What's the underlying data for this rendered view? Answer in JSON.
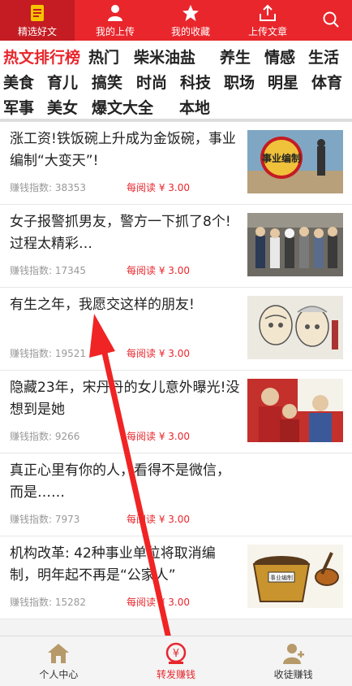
{
  "top_tabs": [
    {
      "label": "精选好文",
      "icon": "article-icon"
    },
    {
      "label": "我的上传",
      "icon": "user-icon"
    },
    {
      "label": "我的收藏",
      "icon": "star-icon"
    },
    {
      "label": "上传文章",
      "icon": "upload-icon"
    },
    {
      "label": "",
      "icon": "search-icon"
    }
  ],
  "categories": {
    "row1": [
      "热文排行榜",
      "热门",
      "柴米油盐",
      "养生",
      "情感",
      "生活"
    ],
    "row2": [
      "美食",
      "育儿",
      "搞笑",
      "时尚",
      "科技",
      "职场",
      "明星",
      "体育"
    ],
    "row3": [
      "军事",
      "美女",
      "爆文大全",
      "本地"
    ]
  },
  "articles": [
    {
      "title": "涨工资!铁饭碗上升成为金饭碗，事业编制“大变天”!",
      "index_label": "赚钱指数: 38353",
      "reward": "每阅读 ¥ 3.00",
      "thumb_text": "事业编制"
    },
    {
      "title": "女子报警抓男友，警方一下抓了8个!过程太精彩…",
      "index_label": "赚钱指数: 17345",
      "reward": "每阅读 ¥ 3.00",
      "thumb_text": ""
    },
    {
      "title": "有生之年，我愿交这样的朋友!",
      "index_label": "赚钱指数: 19521",
      "reward": "每阅读 ¥ 3.00",
      "thumb_text": ""
    },
    {
      "title": "隐藏23年，宋丹丹的女儿意外曝光!没想到是她",
      "index_label": "赚钱指数: 9266",
      "reward": "每阅读 ¥ 3.00",
      "thumb_text": ""
    },
    {
      "title": "真正心里有你的人，看得不是微信，而是……",
      "index_label": "赚钱指数: 7973",
      "reward": "每阅读 ¥ 3.00",
      "thumb_text": ""
    },
    {
      "title": "机构改革: 42种事业单位将取消编制，明年起不再是“公家人”",
      "index_label": "赚钱指数: 15282",
      "reward": "每阅读 ¥ 3.00",
      "thumb_text": "事业编制"
    }
  ],
  "bottom_tabs": [
    {
      "label": "个人中心",
      "icon": "home-icon"
    },
    {
      "label": "转发赚钱",
      "icon": "yuan-coin-icon"
    },
    {
      "label": "收徒赚钱",
      "icon": "person-add-icon"
    }
  ],
  "colors": {
    "brand_red": "#e8262c",
    "brand_red_dark": "#c41c22"
  }
}
